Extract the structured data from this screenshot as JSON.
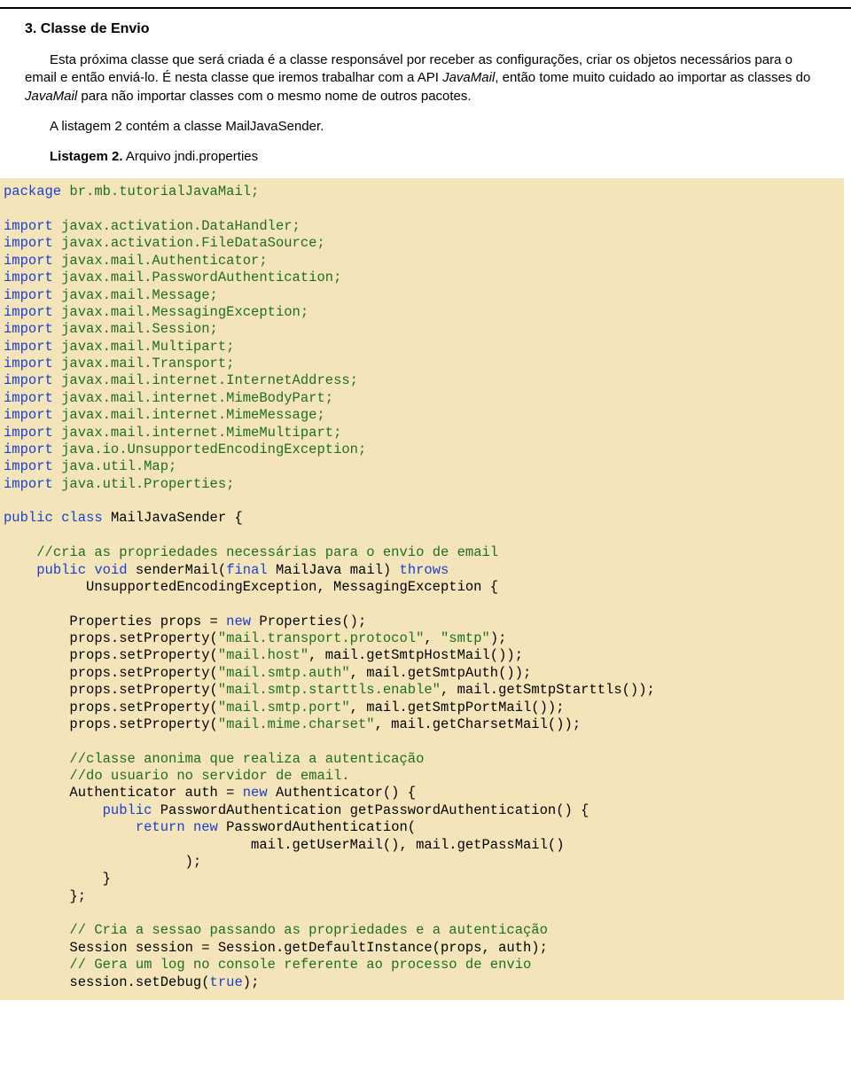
{
  "section": {
    "heading": "3. Classe de Envio",
    "para1_a": "Esta próxima classe que será criada é a classe responsável por receber as configurações, criar os objetos necessários para o email e então enviá-lo. É nesta classe que iremos trabalhar com a API ",
    "para1_b": "JavaMail",
    "para1_c": ", então tome muito cuidado ao importar as classes do ",
    "para1_d": "JavaMail",
    "para1_e": " para não importar classes com o mesmo nome de outros pacotes.",
    "para2": "A listagem 2 contém a classe MailJavaSender.",
    "listing_label": "Listagem 2.",
    "listing_rest": " Arquivo jndi.properties"
  },
  "code": {
    "t01": "package",
    "t02": " br.mb.tutorialJavaMail;",
    "t03": "import",
    "t04": " javax.activation.DataHandler;",
    "t05": " javax.activation.FileDataSource;",
    "t06": " javax.mail.Authenticator;",
    "t07": " javax.mail.PasswordAuthentication;",
    "t08": " javax.mail.Message;",
    "t09": " javax.mail.MessagingException;",
    "t10": " javax.mail.Session;",
    "t11": " javax.mail.Multipart;",
    "t12": " javax.mail.Transport;",
    "t13": " javax.mail.internet.InternetAddress;",
    "t14": " javax.mail.internet.MimeBodyPart;",
    "t15": " javax.mail.internet.MimeMessage;",
    "t16": " javax.mail.internet.MimeMultipart;",
    "t17": " java.io.UnsupportedEncodingException;",
    "t18": " java.util.Map;",
    "t19": " java.util.Properties;",
    "t20": "public",
    "t21": "class",
    "t22": " MailJavaSender {",
    "t23": "//cria as propriedades necessárias para o envio de email",
    "t24": "public",
    "t25": "void",
    "t26": " senderMail(",
    "t27": "final",
    "t28": " MailJava mail) ",
    "t29": "throws",
    "t30": "          UnsupportedEncodingException, MessagingException {",
    "t31": "        Properties props = ",
    "t32": "new",
    "t33": " Properties();",
    "t34": "        props.setProperty(",
    "t35": "\"mail.transport.protocol\"",
    "t36": ", ",
    "t37": "\"smtp\"",
    "t38": ");",
    "t39": "\"mail.host\"",
    "t40": ", mail.getSmtpHostMail());",
    "t41": "\"mail.smtp.auth\"",
    "t42": ", mail.getSmtpAuth());",
    "t43": "\"mail.smtp.starttls.enable\"",
    "t44": ", mail.getSmtpStarttls());",
    "t45": "\"mail.smtp.port\"",
    "t46": ", mail.getSmtpPortMail());",
    "t47": "\"mail.mime.charset\"",
    "t48": ", mail.getCharsetMail());",
    "t49": "//classe anonima que realiza a autenticação",
    "t50": "//do usuario no servidor de email.",
    "t51": "        Authenticator auth = ",
    "t52": " Authenticator() {",
    "t53": " PasswordAuthentication getPasswordAuthentication() {",
    "t54": "return",
    "t55": " PasswordAuthentication(",
    "t56": "                              mail.getUserMail(), mail.getPassMail()",
    "t57": "                      );",
    "t58": "            }",
    "t59": "        };",
    "t60": "// Cria a sessao passando as propriedades e a autenticação",
    "t61": "        Session session = Session.getDefaultInstance(props, auth);",
    "t62": "// Gera um log no console referente ao processo de envio",
    "t63": "        session.setDebug(",
    "t64": "true",
    "t65": ");"
  }
}
